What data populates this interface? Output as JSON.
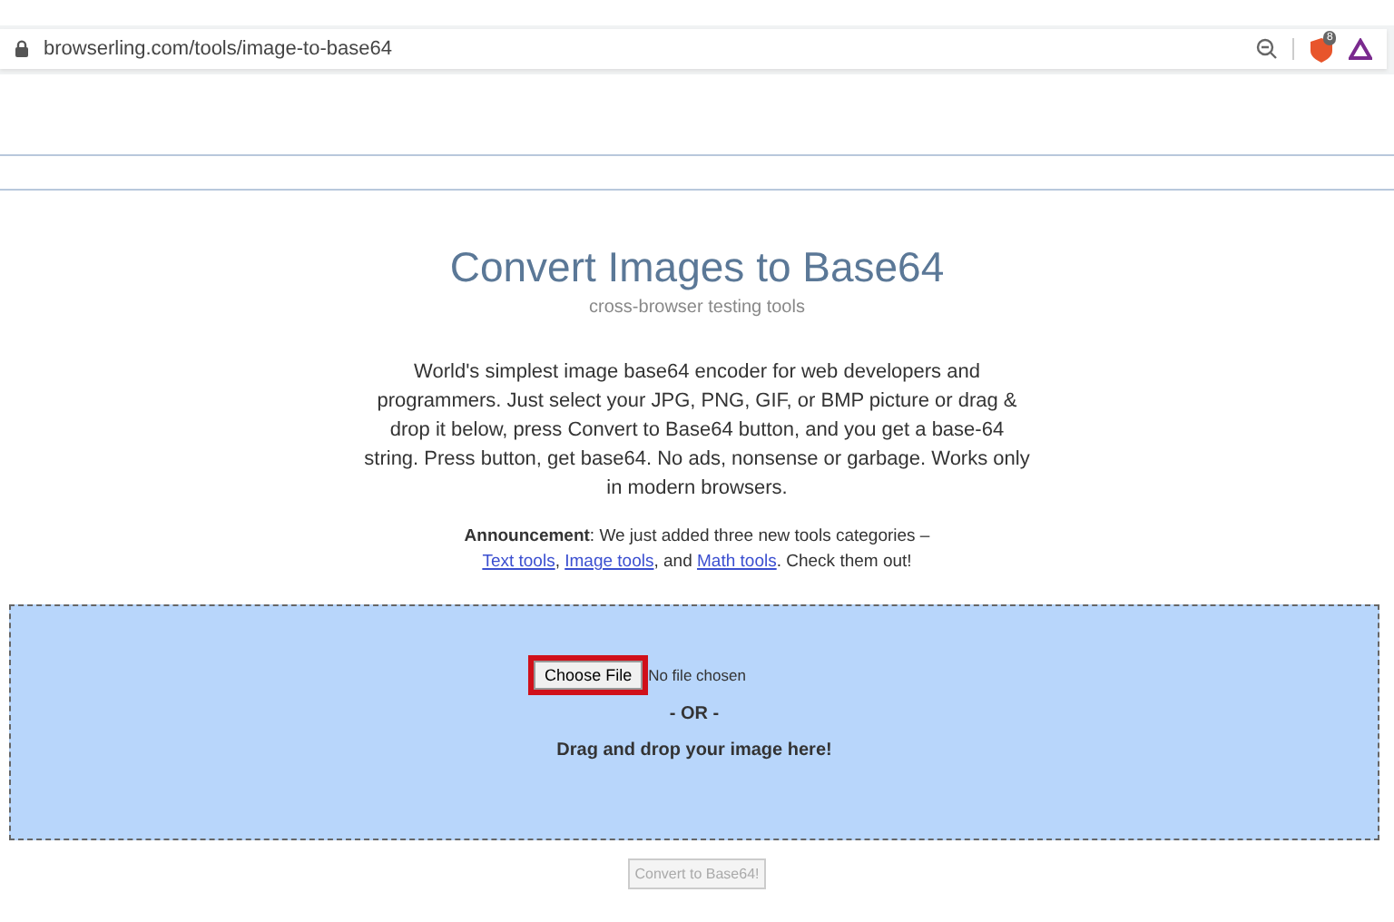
{
  "browser": {
    "url": "browserling.com/tools/image-to-base64",
    "shield_count": "8"
  },
  "header": {
    "title": "Convert Images to Base64",
    "subtitle": "cross-browser testing tools"
  },
  "description": "World's simplest image base64 encoder for web developers and programmers. Just select your JPG, PNG, GIF, or BMP picture or drag & drop it below, press Convert to Base64 button, and you get a base-64 string. Press button, get base64. No ads, nonsense or garbage. Works only in modern browsers.",
  "announcement": {
    "lead": "**Announcement**: We just added three new tools categories –",
    "links": [
      {
        "text": "Text tools",
        "after": ","
      },
      {
        "text": "Image tools",
        "after": ", and"
      },
      {
        "text": "Math tools",
        "after": ". Check them out!"
      }
    ]
  },
  "drop_zone": {
    "choose_button": {
      "label": "Choose File",
      "highlighted": true
    },
    "file_status": "No file chosen",
    "or_text": "- OR -",
    "drag_text": "Drag and drop your image here!"
  },
  "convert_button": {
    "label": "Convert to Base64!",
    "disabled": true
  }
}
